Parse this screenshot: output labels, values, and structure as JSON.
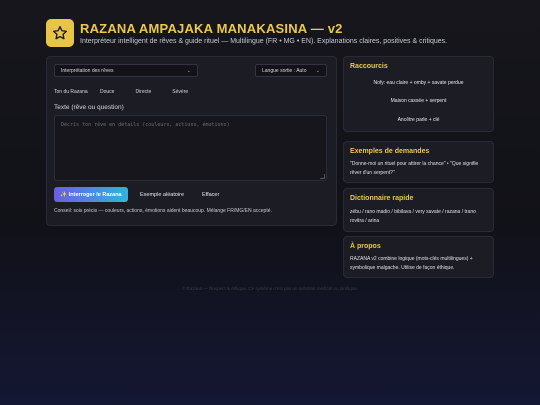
{
  "header": {
    "title": "RAZANA AMPAJAKA MANAKASINA — v2",
    "subtitle": "Interpréteur intelligent de rêves & guide rituel — Multilingue (FR • MG • EN). Explanations claires, positives & critiques.",
    "logo_icon": "star-icon",
    "logo_color": "#e8c547"
  },
  "main": {
    "mode_select": {
      "value": "Interprétation des rêves"
    },
    "lang_select": {
      "value": "Langue sortie : Auto"
    },
    "tone": {
      "label": "Ton du Razana",
      "options": [
        "Douce",
        "Directe",
        "Sévère"
      ]
    },
    "input": {
      "label": "Texte (rêve ou question)",
      "placeholder": "Décris ton rêve en détails (couleurs, actions, émotions)",
      "value": ""
    },
    "buttons": {
      "ask": "✨ Interroger le Razana",
      "example": "Exemple aléatoire",
      "clear": "Effacer"
    },
    "hint": "Conseil: sois précis — couleurs, actions, émotions aident beaucoup. Mélange FR/MG/EN accepté."
  },
  "sidebar": {
    "shortcuts": {
      "title": "Raccourcis",
      "items": [
        "Nofy: eau claire + omby + savate perdue",
        "Maison cassée + serpent",
        "Ancêtre parle + clé"
      ]
    },
    "examples": {
      "title": "Exemples de demandes",
      "text": "\"Donne-moi un rituel pour attirer la chance\" • \"Que signifie rêver d'un serpent?\""
    },
    "dictionary": {
      "title": "Dictionnaire rapide",
      "text": "zébu / rano madio / bibilava / very savate / razana / trano rovitra / arina"
    },
    "about": {
      "title": "À propos",
      "text": "RAZANA v2 combine logique (mots-clés multilingues) + symbolique malgache. Utilise de façon éthique."
    }
  },
  "footer": {
    "text": "© Razana — Respect & éthique. Ce système n'est pas un substitut médical ou juridique."
  },
  "colors": {
    "accent": "#ecc84e",
    "button_gradient_start": "#6a5ee6",
    "button_gradient_end": "#2fb6d8",
    "panel_bg": "#1c1c24"
  }
}
